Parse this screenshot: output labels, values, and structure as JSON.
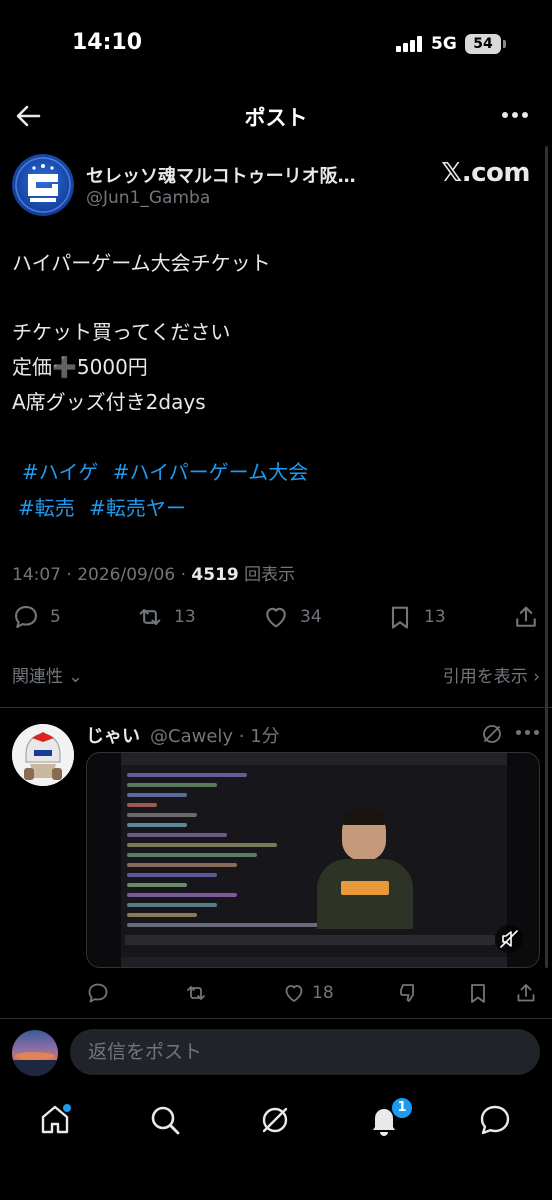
{
  "status_bar": {
    "time": "14:10",
    "network": "5G",
    "battery": "54"
  },
  "nav": {
    "title": "ポスト"
  },
  "author": {
    "name": "セレッソ魂マルコトゥーリオ阪…",
    "handle": "@Jun1_Gamba",
    "source": "𝕏.com"
  },
  "tweet": {
    "line1": "ハイパーゲーム大会チケット",
    "line2": "チケット買ってください",
    "line3": "定価➕5000円",
    "line4": "A席グッズ付き2days",
    "hashtags_row1": [
      "#ハイゲ",
      "#ハイパーゲーム大会"
    ],
    "hashtags_row2": [
      "#転売",
      "#転売ヤー"
    ]
  },
  "meta": {
    "timestamp": "14:07 · 2026/09/06 · ",
    "views_count": "4519",
    "views_label": " 回表示"
  },
  "actions": {
    "replies": "5",
    "reposts": "13",
    "likes": "34",
    "bookmarks": "13"
  },
  "sort": {
    "relevance": "関連性 ⌄",
    "quotes": "引用を表示 ›"
  },
  "reply": {
    "name": "じゃい",
    "handle": "@Cawely · 1分",
    "likes": "18"
  },
  "compose": {
    "placeholder": "返信をポスト"
  },
  "tabs": {
    "notification_count": "1"
  },
  "colors": {
    "accent": "#1d9bf0",
    "background": "#000000",
    "text_secondary": "#71767b"
  }
}
